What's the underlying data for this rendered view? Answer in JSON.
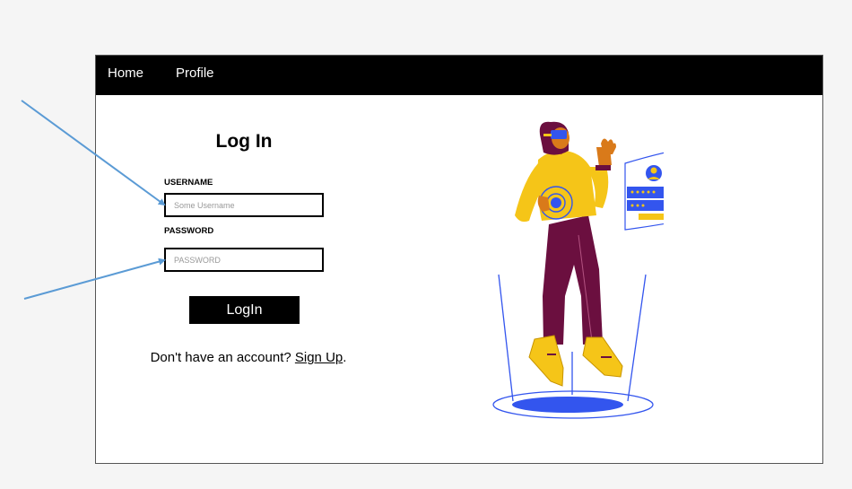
{
  "nav": {
    "home": "Home",
    "profile": "Profile"
  },
  "login": {
    "title": "Log In",
    "username_label": "USERNAME",
    "username_placeholder": "Some Username",
    "password_label": "PASSWORD",
    "password_placeholder": "PASSWORD",
    "button_label": "LogIn",
    "signup_prompt": "Don't have an account? ",
    "signup_link": "Sign Up",
    "signup_end": "."
  },
  "illustration": {
    "icon": "person-login-hologram-illustration"
  },
  "annotations": {
    "icon": "arrow-icon",
    "color": "#5b9bd5"
  },
  "colors": {
    "navbar": "#000000",
    "button": "#000000",
    "accent_blue": "#3355ee",
    "accent_yellow": "#f5c518",
    "pants": "#6b0f3f"
  }
}
